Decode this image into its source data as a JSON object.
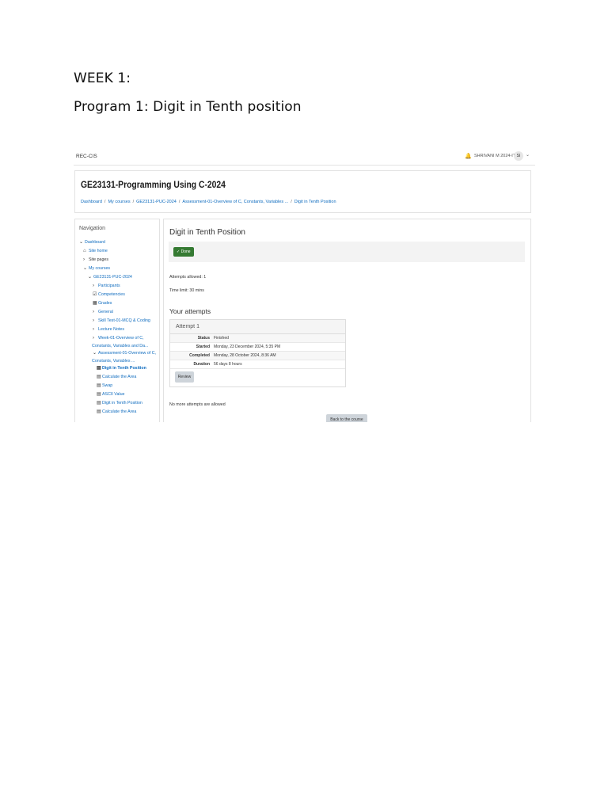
{
  "document": {
    "week_heading": "WEEK 1:",
    "program_heading": "Program 1: Digit in Tenth position"
  },
  "screenshot": {
    "site_name": "REC-CIS",
    "user_name": "SHRIVANI M 2024-IT",
    "avatar_initials": "SI",
    "course_title": "GE23131-Programming Using C-2024",
    "breadcrumb": [
      "Dashboard",
      "My courses",
      "GE23131-PUC-2024",
      "Assessment-01-Overview of C, Constants, Variables ...",
      "Digit in Tenth Position"
    ],
    "navigation": {
      "title": "Navigation",
      "items": [
        {
          "label": "Dashboard",
          "glyph": "⌄"
        },
        {
          "label": "Site home",
          "glyph": "⌂"
        },
        {
          "label": "Site pages",
          "glyph": "›"
        },
        {
          "label": "My courses",
          "glyph": "⌄"
        },
        {
          "label": "GE23131-PUC-2024",
          "glyph": "⌄"
        },
        {
          "label": "Participants",
          "glyph": "›"
        },
        {
          "label": "Competencies",
          "glyph": "☑"
        },
        {
          "label": "Grades",
          "glyph": "▦"
        },
        {
          "label": "General",
          "glyph": "›"
        },
        {
          "label": "Skill Test-01-MCQ & Coding",
          "glyph": "›"
        },
        {
          "label": "Lecture Notes",
          "glyph": "›"
        },
        {
          "label": "Week-01-Overview of C,",
          "label2": "Constants, Variables and Da...",
          "glyph": "›"
        },
        {
          "label": "Assessment-01-Overview of C,",
          "label2": "Constants, Variables ...",
          "glyph": "⌄"
        },
        {
          "label": "Digit in Tenth Position",
          "glyph": "▤"
        },
        {
          "label": "Calculate the Area",
          "glyph": "▤"
        },
        {
          "label": "Swap",
          "glyph": "▤"
        },
        {
          "label": "ASCII Value",
          "glyph": "▤"
        },
        {
          "label": "Digit in Tenth Position",
          "glyph": "▤"
        },
        {
          "label": "Calculate the Area",
          "glyph": "▤"
        }
      ]
    },
    "activity": {
      "title": "Digit in Tenth Position",
      "done_label": "✓ Done",
      "attempts_allowed": "Attempts allowed: 1",
      "time_limit": "Time limit: 30 mins",
      "attempts_heading": "Your attempts",
      "attempt": {
        "title": "Attempt 1",
        "rows": [
          {
            "key": "Status",
            "value": "Finished"
          },
          {
            "key": "Started",
            "value": "Monday, 23 December 2024, 5:35 PM"
          },
          {
            "key": "Completed",
            "value": "Monday, 28 October 2024, 8:36 AM"
          },
          {
            "key": "Duration",
            "value": "56 days 8 hours"
          }
        ],
        "review_label": "Review"
      },
      "no_more_attempts": "No more attempts are allowed",
      "back_label": "Back to the course"
    }
  }
}
